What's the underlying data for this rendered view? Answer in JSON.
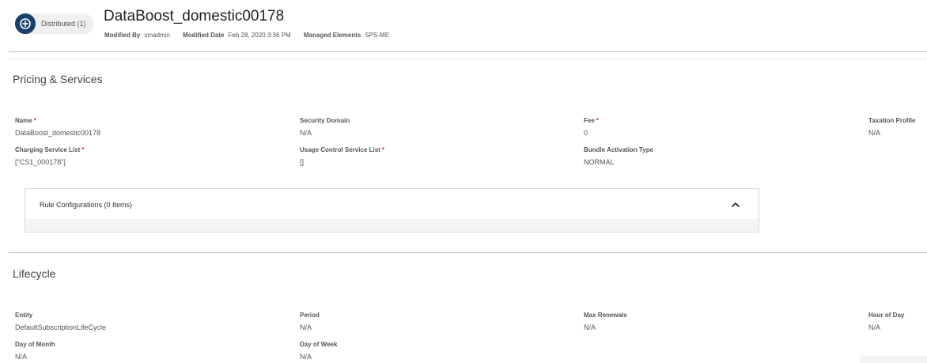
{
  "header": {
    "status_label": "Distributed (1)",
    "title": "DataBoost_domestic00178",
    "meta": [
      {
        "key": "Modified By",
        "value": "smadmin"
      },
      {
        "key": "Modified Date",
        "value": "Feb 28, 2020 3:36 PM"
      },
      {
        "key": "Managed Elements",
        "value": "SPS-ME"
      }
    ]
  },
  "pricing": {
    "title": "Pricing & Services",
    "fields": [
      {
        "label": "Name",
        "required": true,
        "value": "DataBoost_domestic00178"
      },
      {
        "label": "Security Domain",
        "required": false,
        "value": "N/A"
      },
      {
        "label": "Fee",
        "required": true,
        "value": "0"
      },
      {
        "label": "Taxation Profile",
        "required": false,
        "value": "N/A"
      },
      {
        "label": "Charging Service List",
        "required": true,
        "value": "[\"CS1_000178\"]"
      },
      {
        "label": "Usage Control Service List",
        "required": true,
        "value": "[]"
      },
      {
        "label": "Bundle Activation Type",
        "required": false,
        "value": "NORMAL"
      }
    ],
    "rules_label": "Rule Configurations (0 Items)"
  },
  "lifecycle": {
    "title": "Lifecycle",
    "fields": [
      {
        "label": "Entity",
        "value": "DefaultSubscriptionLifeCycle"
      },
      {
        "label": "Period",
        "value": "N/A"
      },
      {
        "label": "Max Renewals",
        "value": "N/A"
      },
      {
        "label": "Hour of Day",
        "value": "N/A"
      },
      {
        "label": "Day of Month",
        "value": "N/A"
      },
      {
        "label": "Day of Week",
        "value": "N/A"
      }
    ]
  },
  "colors": {
    "accent": "#1b3f6b",
    "required": "#c0392b"
  },
  "icons": {
    "status": "plus-circle-icon",
    "collapse": "chevron-up-icon"
  }
}
